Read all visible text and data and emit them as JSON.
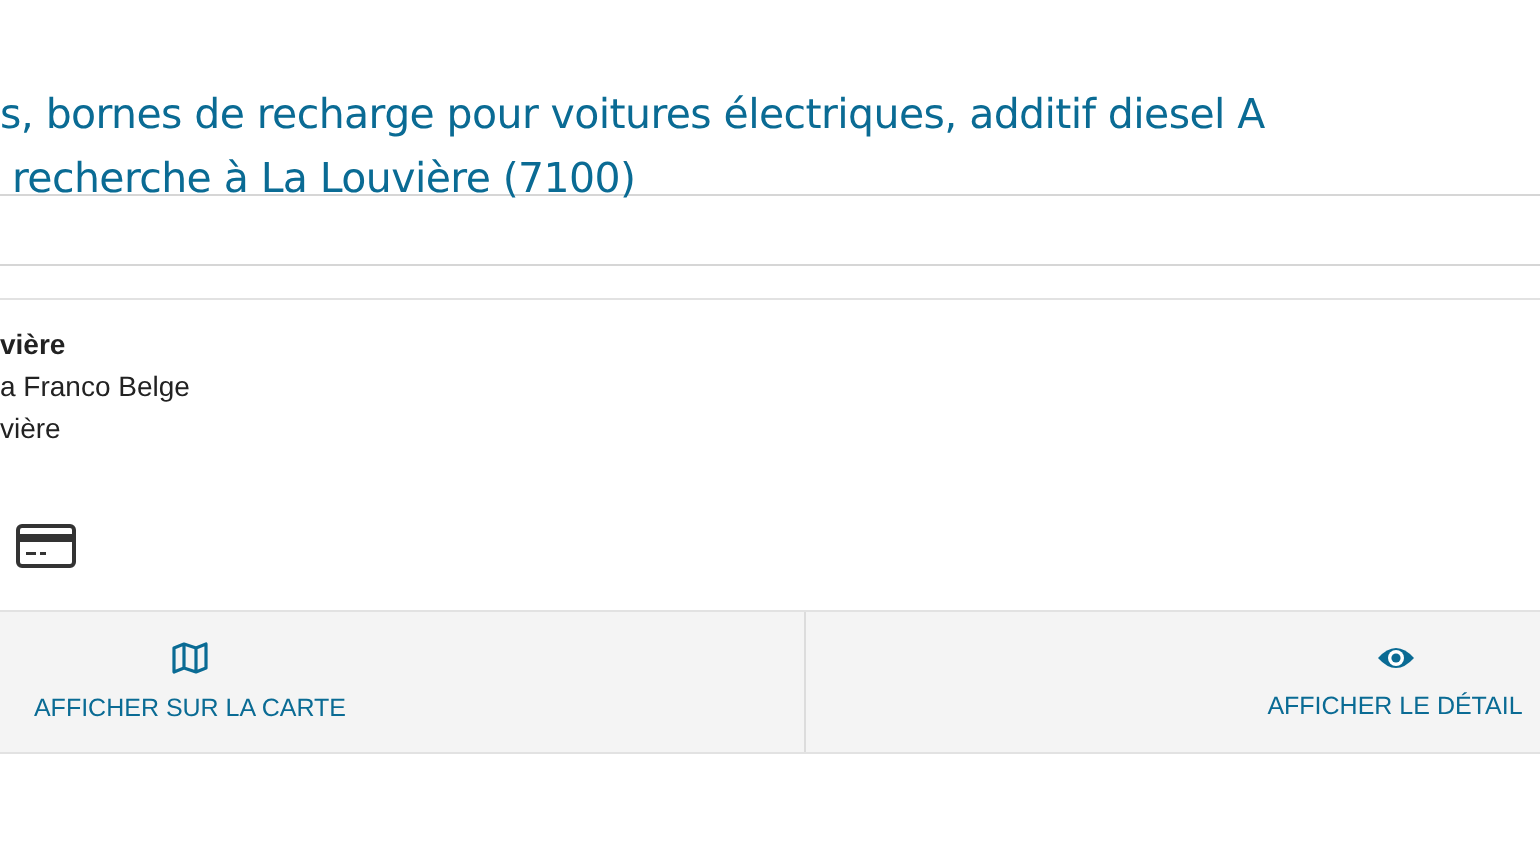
{
  "title_lines": [
    "s, bornes de recharge pour voitures électriques, additif diesel A",
    "recherche à La Louvière (7100)"
  ],
  "result": {
    "name": "vière",
    "address_lines": [
      "a Franco Belge",
      "vière"
    ]
  },
  "actions": [
    {
      "label": "AFFICHER SUR LA CARTE",
      "kind": "map"
    },
    {
      "label": "AFFICHER LE DÉTAIL",
      "kind": "eye"
    }
  ]
}
